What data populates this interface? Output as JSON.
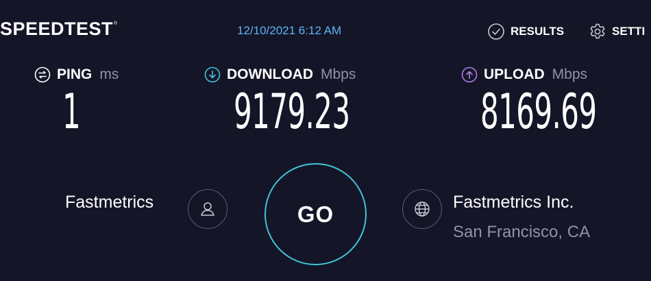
{
  "header": {
    "logo": "SPEEDTEST",
    "logo_mark": "®",
    "timestamp": "12/10/2021 6:12 AM",
    "nav": {
      "results_label": "RESULTS",
      "results_icon": "check-circle-icon",
      "settings_label": "SETTI",
      "settings_icon": "gear-icon"
    }
  },
  "metrics": {
    "ping": {
      "label": "PING",
      "unit": "ms",
      "value": "1",
      "icon": "ping-icon"
    },
    "download": {
      "label": "DOWNLOAD",
      "unit": "Mbps",
      "value": "9179.23",
      "icon": "download-arrow-icon",
      "color": "#3ec6d6"
    },
    "upload": {
      "label": "UPLOAD",
      "unit": "Mbps",
      "value": "8169.69",
      "icon": "upload-arrow-icon",
      "color": "#b07de8"
    }
  },
  "isp": {
    "name": "Fastmetrics",
    "icon": "user-icon"
  },
  "go_button": {
    "label": "GO",
    "color": "#3ec6d6"
  },
  "server": {
    "name": "Fastmetrics Inc.",
    "location": "San Francisco, CA",
    "icon": "globe-icon"
  }
}
